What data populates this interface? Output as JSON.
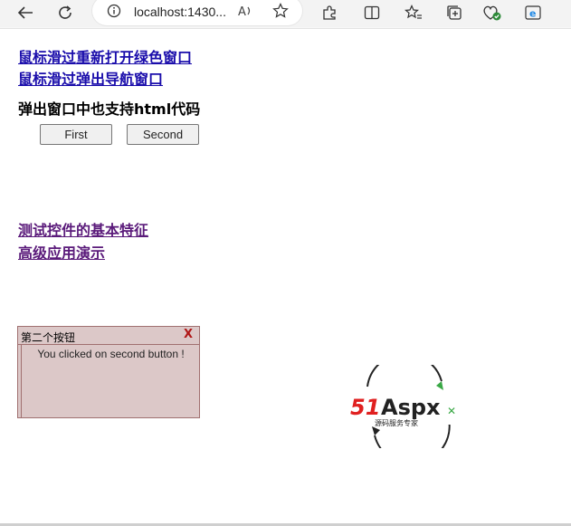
{
  "browser": {
    "url": "localhost:1430...",
    "icons": [
      "back-icon",
      "refresh-icon",
      "info-icon",
      "read-aloud-icon",
      "favorite-icon",
      "extensions-icon",
      "split-screen-icon",
      "favorites-icon",
      "collections-icon",
      "browser-essentials-icon",
      "edge-icon"
    ]
  },
  "links": {
    "reopen_green": "鼠标滑过重新打开绿色窗口",
    "popup_nav": "鼠标滑过弹出导航窗口",
    "basic_features": "测试控件的基本特征",
    "advanced_demo": "高级应用演示"
  },
  "heading": "弹出窗口中也支持html代码",
  "buttons": {
    "first": "First",
    "second": "Second"
  },
  "popup": {
    "title": "第二个按钮",
    "close": "X",
    "message": "You clicked on second button !"
  },
  "logo": {
    "brand": "51Aspx",
    "tagline": "源码服务专家",
    "colors": {
      "red": "#e02020",
      "green": "#39a845",
      "dark": "#222222"
    }
  }
}
